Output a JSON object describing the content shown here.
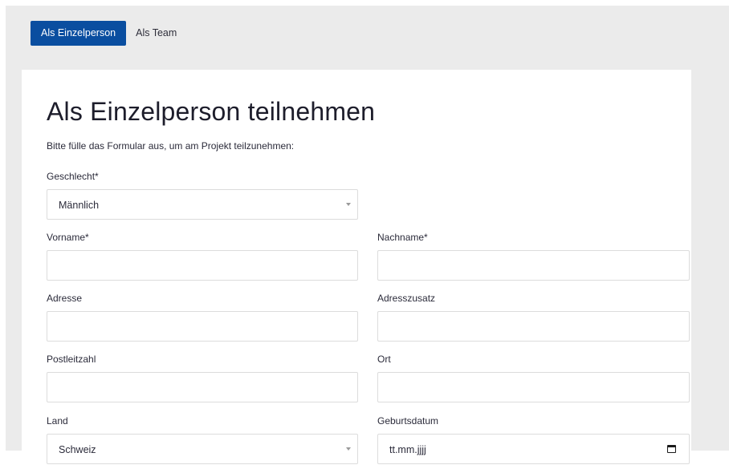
{
  "tabs": [
    {
      "label": "Als Einzelperson",
      "active": true
    },
    {
      "label": "Als Team",
      "active": false
    }
  ],
  "form": {
    "title": "Als Einzelperson teilnehmen",
    "intro": "Bitte fülle das Formular aus, um am Projekt teilzunehmen:",
    "geschlecht": {
      "label": "Geschlecht*",
      "value": "Männlich"
    },
    "vorname": {
      "label": "Vorname*",
      "value": ""
    },
    "nachname": {
      "label": "Nachname*",
      "value": ""
    },
    "adresse": {
      "label": "Adresse",
      "value": ""
    },
    "adresszusatz": {
      "label": "Adresszusatz",
      "value": ""
    },
    "postleitzahl": {
      "label": "Postleitzahl",
      "value": ""
    },
    "ort": {
      "label": "Ort",
      "value": ""
    },
    "land": {
      "label": "Land",
      "value": "Schweiz"
    },
    "geburtsdatum": {
      "label": "Geburtsdatum",
      "placeholder": "tt.mm.jjjj"
    }
  },
  "colors": {
    "accent": "#0a4ea0",
    "page_background": "#ebebeb",
    "card_background": "#ffffff",
    "field_border": "#dcdcdc"
  },
  "icons": {
    "select_arrow": "chevron-down-icon",
    "date_picker": "calendar-icon"
  }
}
